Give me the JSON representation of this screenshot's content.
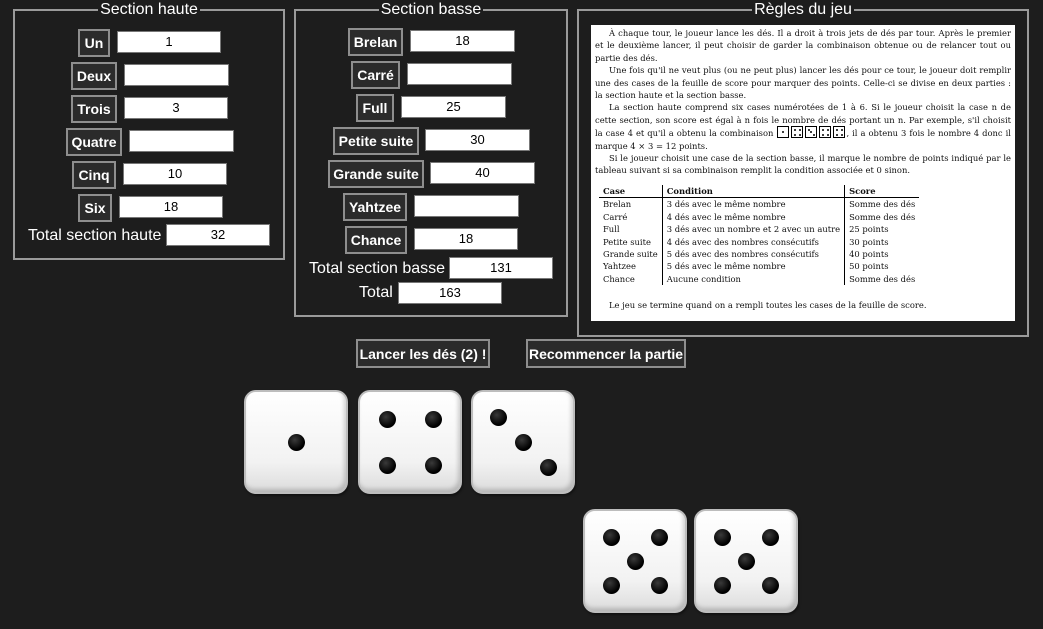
{
  "upper_section": {
    "legend": "Section haute",
    "rows": [
      {
        "label": "Un",
        "value": "1"
      },
      {
        "label": "Deux",
        "value": ""
      },
      {
        "label": "Trois",
        "value": "3"
      },
      {
        "label": "Quatre",
        "value": ""
      },
      {
        "label": "Cinq",
        "value": "10"
      },
      {
        "label": "Six",
        "value": "18"
      }
    ],
    "total_label": "Total section haute",
    "total_value": "32"
  },
  "lower_section": {
    "legend": "Section basse",
    "rows": [
      {
        "label": "Brelan",
        "value": "18"
      },
      {
        "label": "Carré",
        "value": ""
      },
      {
        "label": "Full",
        "value": "25"
      },
      {
        "label": "Petite suite",
        "value": "30"
      },
      {
        "label": "Grande suite",
        "value": "40"
      },
      {
        "label": "Yahtzee",
        "value": ""
      },
      {
        "label": "Chance",
        "value": "18"
      }
    ],
    "total_label": "Total section basse",
    "total_value": "131",
    "grand_total_label": "Total",
    "grand_total_value": "163"
  },
  "rules": {
    "legend": "Règles du jeu",
    "p1": "À chaque tour, le joueur lance les dés. Il a droit à trois jets de dés par tour. Après le premier et le deuxième lancer, il peut choisir de garder la combinaison obtenue ou de relancer tout ou partie des dés.",
    "p2": "Une fois qu'il ne veut plus (ou ne peut plus) lancer les dés pour ce tour, le joueur doit remplir une des cases de la feuille de score pour marquer des points. Celle-ci se divise en deux parties : la section haute et la section basse.",
    "p3a": "La section haute comprend six cases numérotées de 1 à 6. Si le joueur choisit la case n de cette section, son score est égal à n fois le nombre de dés portant un n. Par exemple, s'il choisit la case 4 et qu'il a obtenu la combinaison",
    "p3b": ", il a obtenu 3 fois le nombre 4 donc il marque 4 × 3 = 12 points.",
    "p4": "Si le joueur choisit une case de la section basse, il marque le nombre de points indiqué par le tableau suivant si sa combinaison remplit la condition associée et 0 sinon.",
    "table_headers": [
      "Case",
      "Condition",
      "Score"
    ],
    "table_rows": [
      [
        "Brelan",
        "3 dés avec le même nombre",
        "Somme des dés"
      ],
      [
        "Carré",
        "4 dés avec le même nombre",
        "Somme des dés"
      ],
      [
        "Full",
        "3 dés avec un nombre et 2 avec un autre",
        "25 points"
      ],
      [
        "Petite suite",
        "4 dés avec des nombres consécutifs",
        "30 points"
      ],
      [
        "Grande suite",
        "5 dés avec des nombres consécutifs",
        "40 points"
      ],
      [
        "Yahtzee",
        "5 dés avec le même nombre",
        "50 points"
      ],
      [
        "Chance",
        "Aucune condition",
        "Somme des dés"
      ]
    ],
    "example_dice": [
      1,
      4,
      3,
      4,
      4
    ],
    "endnote": "Le jeu se termine quand on a rempli toutes les cases de la feuille de score."
  },
  "controls": {
    "roll_label": "Lancer les dés (2) !",
    "restart_label": "Recommencer la partie"
  },
  "dice": [
    {
      "value": 1,
      "kept": false
    },
    {
      "value": 4,
      "kept": false
    },
    {
      "value": 3,
      "kept": false
    },
    {
      "value": 5,
      "kept": true
    },
    {
      "value": 5,
      "kept": true
    }
  ]
}
